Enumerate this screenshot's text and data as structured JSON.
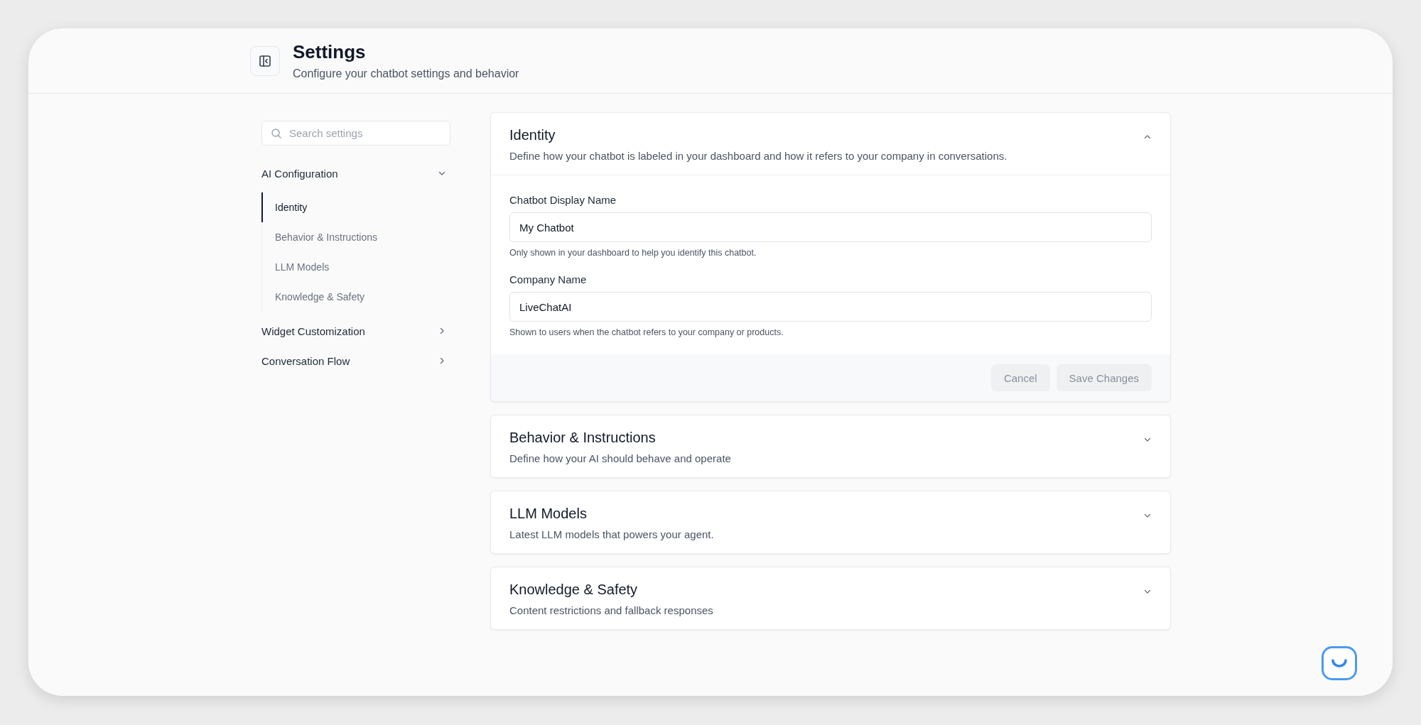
{
  "header": {
    "title": "Settings",
    "subtitle": "Configure your chatbot settings and behavior"
  },
  "sidebar": {
    "search": {
      "placeholder": "Search settings"
    },
    "groups": [
      {
        "label": "AI Configuration",
        "expanded": true,
        "children": [
          {
            "label": "Identity",
            "selected": true
          },
          {
            "label": "Behavior & Instructions",
            "selected": false
          },
          {
            "label": "LLM Models",
            "selected": false
          },
          {
            "label": "Knowledge & Safety",
            "selected": false
          }
        ]
      },
      {
        "label": "Widget Customization",
        "expanded": false
      },
      {
        "label": "Conversation Flow",
        "expanded": false
      }
    ]
  },
  "sections": [
    {
      "title": "Identity",
      "description": "Define how your chatbot is labeled in your dashboard and how it refers to your company in conversations.",
      "expanded": true,
      "fields": [
        {
          "label": "Chatbot Display Name",
          "value": "My Chatbot",
          "hint": "Only shown in your dashboard to help you identify this chatbot."
        },
        {
          "label": "Company Name",
          "value": "LiveChatAI",
          "hint": "Shown to users when the chatbot refers to your company or products."
        }
      ],
      "buttons": [
        {
          "label": "Cancel",
          "disabled": true
        },
        {
          "label": "Save Changes",
          "disabled": true
        }
      ]
    },
    {
      "title": "Behavior & Instructions",
      "description": "Define how your AI should behave and operate",
      "expanded": false
    },
    {
      "title": "LLM Models",
      "description": "Latest LLM models that powers your agent.",
      "expanded": false
    },
    {
      "title": "Knowledge & Safety",
      "description": "Content restrictions and fallback responses",
      "expanded": false
    }
  ]
}
